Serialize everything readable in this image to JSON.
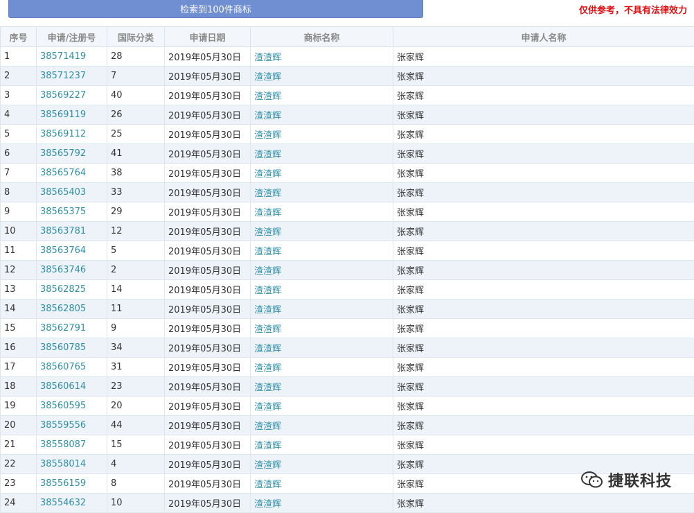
{
  "header": {
    "result_banner": "检索到100件商标",
    "disclaimer": "仅供参考，不具有法律效力"
  },
  "table": {
    "columns": [
      "序号",
      "申请/注册号",
      "国际分类",
      "申请日期",
      "商标名称",
      "申请人名称"
    ],
    "rows": [
      [
        "1",
        "38571419",
        "28",
        "2019年05月30日",
        "渣渣辉",
        "张家辉"
      ],
      [
        "2",
        "38571237",
        "7",
        "2019年05月30日",
        "渣渣辉",
        "张家辉"
      ],
      [
        "3",
        "38569227",
        "40",
        "2019年05月30日",
        "渣渣辉",
        "张家辉"
      ],
      [
        "4",
        "38569119",
        "26",
        "2019年05月30日",
        "渣渣辉",
        "张家辉"
      ],
      [
        "5",
        "38569112",
        "25",
        "2019年05月30日",
        "渣渣辉",
        "张家辉"
      ],
      [
        "6",
        "38565792",
        "41",
        "2019年05月30日",
        "渣渣辉",
        "张家辉"
      ],
      [
        "7",
        "38565764",
        "38",
        "2019年05月30日",
        "渣渣辉",
        "张家辉"
      ],
      [
        "8",
        "38565403",
        "33",
        "2019年05月30日",
        "渣渣辉",
        "张家辉"
      ],
      [
        "9",
        "38565375",
        "29",
        "2019年05月30日",
        "渣渣辉",
        "张家辉"
      ],
      [
        "10",
        "38563781",
        "12",
        "2019年05月30日",
        "渣渣辉",
        "张家辉"
      ],
      [
        "11",
        "38563764",
        "5",
        "2019年05月30日",
        "渣渣辉",
        "张家辉"
      ],
      [
        "12",
        "38563746",
        "2",
        "2019年05月30日",
        "渣渣辉",
        "张家辉"
      ],
      [
        "13",
        "38562825",
        "14",
        "2019年05月30日",
        "渣渣辉",
        "张家辉"
      ],
      [
        "14",
        "38562805",
        "11",
        "2019年05月30日",
        "渣渣辉",
        "张家辉"
      ],
      [
        "15",
        "38562791",
        "9",
        "2019年05月30日",
        "渣渣辉",
        "张家辉"
      ],
      [
        "16",
        "38560785",
        "34",
        "2019年05月30日",
        "渣渣辉",
        "张家辉"
      ],
      [
        "17",
        "38560765",
        "31",
        "2019年05月30日",
        "渣渣辉",
        "张家辉"
      ],
      [
        "18",
        "38560614",
        "23",
        "2019年05月30日",
        "渣渣辉",
        "张家辉"
      ],
      [
        "19",
        "38560595",
        "20",
        "2019年05月30日",
        "渣渣辉",
        "张家辉"
      ],
      [
        "20",
        "38559556",
        "44",
        "2019年05月30日",
        "渣渣辉",
        "张家辉"
      ],
      [
        "21",
        "38558087",
        "15",
        "2019年05月30日",
        "渣渣辉",
        "张家辉"
      ],
      [
        "22",
        "38558014",
        "4",
        "2019年05月30日",
        "渣渣辉",
        "张家辉"
      ],
      [
        "23",
        "38556159",
        "8",
        "2019年05月30日",
        "渣渣辉",
        "张家辉"
      ],
      [
        "24",
        "38554632",
        "10",
        "2019年05月30日",
        "渣渣辉",
        "张家辉"
      ]
    ]
  },
  "watermark": {
    "icon": "wechat-icon",
    "text": "捷联科技"
  },
  "colors": {
    "banner_bg": "#6f8fd2",
    "disclaimer": "#e01010",
    "link": "#2f8fa8",
    "row_alt": "#eef3fa"
  }
}
